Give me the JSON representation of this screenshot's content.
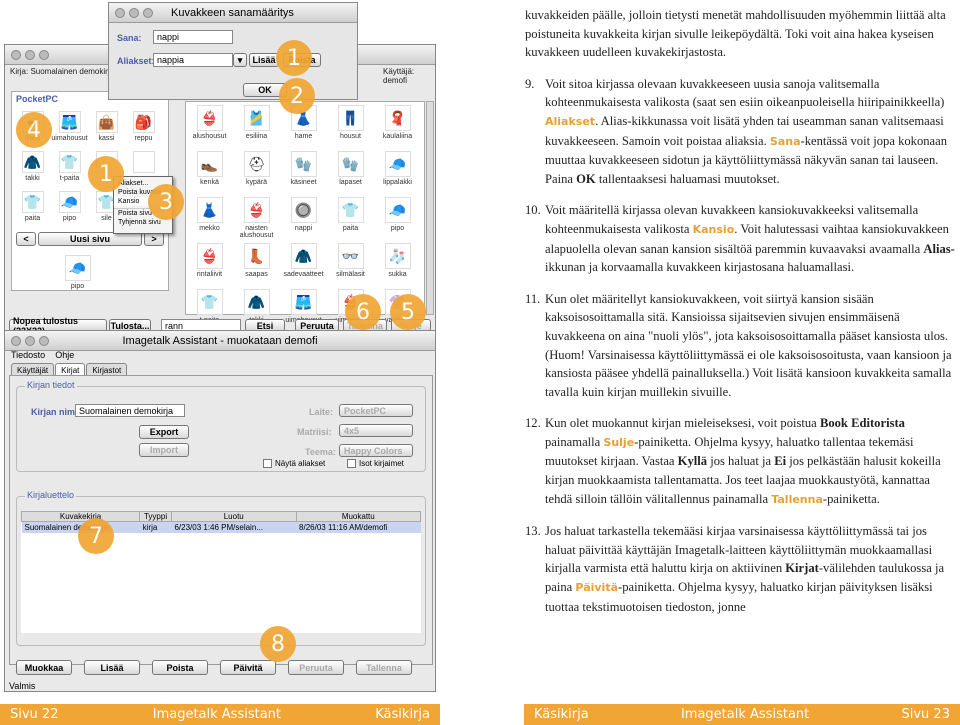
{
  "paragraph_intro": "kuvakkeiden päälle, jolloin tietysti menetät mahdollisuuden myöhemmin liittää alta poistuneita kuvakkeita kirjan sivulle leikepöydältä. Toki voit aina hakea kyseisen kuvakkeen uudelleen kuvakekirjastosta.",
  "p9": {
    "num": "9.",
    "t1": "Voit sitoa kirjassa olevaan kuvakkeeseen uusia sanoja valitsemalla kohteenmukaisesta valikosta (saat sen esiin oikeanpuoleisella hiiripainikkeella) ",
    "h1": "Aliakset",
    "t2": ". Alias-kikkunassa voit lisätä yhden tai useamman sanan valitsemaasi kuvakkeeseen. Samoin voit poistaa aliaksia. ",
    "h2": "Sana",
    "t3": "-kentässä voit jopa kokonaan muuttaa kuvakkeeseen sidotun ja käyttöliittymässä näkyvän sanan tai lauseen. Paina ",
    "b1": "OK",
    "t4": " tallentaaksesi haluamasi muutokset."
  },
  "p10": {
    "num": "10.",
    "t1": "Voit määritellä kirjassa olevan kuvakkeen kansiokuvakkeeksi valitsemalla kohteenmukaisesta valikosta ",
    "h1": "Kansio",
    "t2": ". Voit halutessasi vaihtaa kansiokuvakkeen alapuolella olevan sanan kansion sisältöä paremmin kuvaavaksi avaamalla ",
    "b1": "Alias-",
    "t3": "ikkunan ja korvaamalla kuvakkeen kirjastosana haluamallasi."
  },
  "p11": {
    "num": "11.",
    "t1": "Kun olet määritellyt kansiokuvakkeen, voit siirtyä kansion sisään kaksoisosoittamalla sitä. Kansioissa sijaitsevien sivujen ensimmäisenä kuvakkeena on aina \"nuoli ylös\", jota kaksoisosoittamalla pääset kansiosta ulos. (Huom! Varsinaisessa käyttöliittymässä ei ole kaksoisosoitusta, vaan kansioon ja kansiosta pääsee yhdellä painalluksella.) Voit lisätä kansioon kuvakkeita samalla tavalla kuin kirjan muillekin sivuille."
  },
  "p12": {
    "num": "12.",
    "t1": "Kun olet muokannut kirjan mieleiseksesi, voit poistua ",
    "b1": "Book Editorista",
    "t2": " painamalla ",
    "h1": "Sulje",
    "t3": "-painiketta. Ohjelma kysyy, haluatko tallentaa tekemäsi muutokset kirjaan. Vastaa ",
    "b2": "Kyllä",
    "t4": " jos haluat ja ",
    "b3": "Ei",
    "t5": " jos pelkästään halusit kokeilla kirjan muokkaamista tallentamatta. Jos teet laajaa muokkaustyötä, kannattaa tehdä silloin tällöin välitallennus painamalla ",
    "h2": "Tallenna",
    "t6": "-painiketta."
  },
  "p13": {
    "num": "13.",
    "t1": "Jos haluat tarkastella tekemääsi kirjaa varsinaisessa käyttöliittymässä tai jos haluat päivittää käyttäjän Imagetalk-laitteen käyttöliittymän muokkaamallasi kirjalla varmista että haluttu kirja on aktiivinen ",
    "b1": "Kirjat",
    "t2": "-välilehden taulukossa ja paina ",
    "h1": "Päivitä",
    "t3": "-painiketta. Ohjelma kysyy, haluatko kirjan päivityksen lisäksi tuottaa tekstimuotoisen tiedoston, jonne"
  },
  "footer_left": {
    "page": "Sivu 22",
    "app": "Imagetalk Assistant",
    "section": "Käsikirja"
  },
  "footer_right": {
    "section": "Käsikirja",
    "app": "Imagetalk Assistant",
    "page": "Sivu 23"
  },
  "alias_dialog": {
    "title": "Kuvakkeen sanamääritys",
    "word_label": "Sana:",
    "word_value": "nappi",
    "alias_label": "Aliakset:",
    "alias_value": "nappia",
    "add": "Lisää",
    "remove": "Poista",
    "ok": "OK"
  },
  "editor": {
    "book_label": "Kirja: Suomalainen demokirja (68",
    "user_label": "Käyttäjä: demofi",
    "pocketpc": "PocketPC",
    "left_icons": [
      "Back",
      "uimahousut",
      "kassi",
      "reppu",
      "takki",
      "t-paita",
      "",
      "",
      "paita",
      "pipo",
      "sile"
    ],
    "page_prev": "<",
    "page_name": "Uusi sivu",
    "page_next": ">",
    "left_bottom": "pipo",
    "speed": "Nopea tulostus (32X32)",
    "print_btn": "Tulosta...",
    "search_value": "rann",
    "find": "Etsi",
    "cancel": "Peruuta",
    "save": "Tallenna",
    "close": "Sulje"
  },
  "context_menu": [
    "Aliakset...",
    "Poista kuvake",
    "Kansio",
    "Poista sivu",
    "Tyhjennä sivu"
  ],
  "icon_rows": [
    [
      "alushousut",
      "esiliina",
      "hame",
      "housut",
      "kaulaliina"
    ],
    [
      "kenkä",
      "kypärä",
      "käsineet",
      "lapaset",
      "lippalakki"
    ],
    [
      "mekko",
      "naisten alushousut",
      "nappi",
      "paita",
      "pipo"
    ],
    [
      "rintaliivit",
      "saapas",
      "sadevaatteet",
      "silmälasit",
      "sukka"
    ],
    [
      "t-paita",
      "takki",
      "uimahousut",
      "uimapuku",
      "vaatteet"
    ]
  ],
  "assistant": {
    "title": "Imagetalk Assistant - muokataan demofi",
    "menu1": "Tiedosto",
    "menu2": "Ohje",
    "tabs": [
      "Käyttäjät",
      "Kirjat",
      "Kirjastot"
    ],
    "group1": "Kirjan tiedot",
    "bookname_label": "Kirjan nimi:",
    "bookname_value": "Suomalainen demokirja",
    "export": "Export",
    "import": "Import",
    "laite_label": "Laite:",
    "laite_value": "PocketPC",
    "matriisi_label": "Matriisi:",
    "matriisi_value": "4x5",
    "teema_label": "Teema:",
    "teema_value": "Happy Colors",
    "cb1": "Näytä aliakset",
    "cb2": "Isot kirjaimet",
    "group2": "Kirjaluettelo",
    "cols": [
      "Kuvakekirja",
      "Tyyppi",
      "Luotu",
      "Muokattu"
    ],
    "row": [
      "Suomalainen demokirja",
      "kirja",
      "6/23/03 1:46 PM/selain...",
      "8/26/03 11:16 AM/demofi"
    ],
    "buttons": [
      "Muokkaa",
      "Lisää",
      "Poista",
      "Päivitä",
      "Peruuta",
      "Tallenna"
    ],
    "status": "Valmis"
  },
  "badges": [
    "1",
    "2",
    "4",
    "1",
    "3",
    "6",
    "5",
    "7",
    "8"
  ]
}
